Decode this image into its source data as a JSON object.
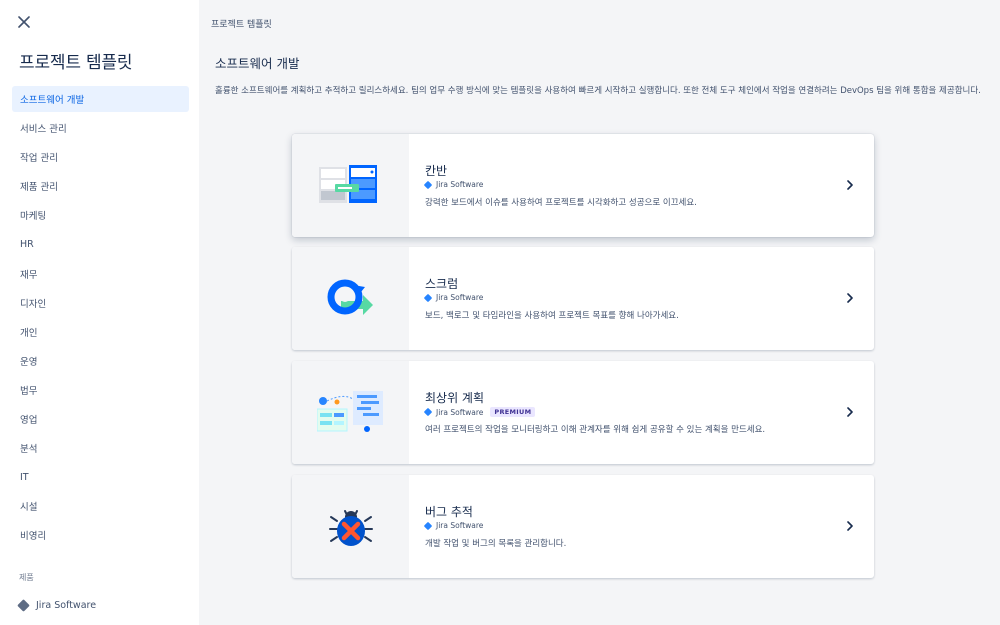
{
  "sidebar": {
    "title": "프로젝트 템플릿",
    "items": [
      {
        "label": "소프트웨어 개발"
      },
      {
        "label": "서비스 관리"
      },
      {
        "label": "작업 관리"
      },
      {
        "label": "제품 관리"
      },
      {
        "label": "마케팅"
      },
      {
        "label": "HR"
      },
      {
        "label": "재무"
      },
      {
        "label": "디자인"
      },
      {
        "label": "개인"
      },
      {
        "label": "운영"
      },
      {
        "label": "법무"
      },
      {
        "label": "영업"
      },
      {
        "label": "분석"
      },
      {
        "label": "IT"
      },
      {
        "label": "시설"
      },
      {
        "label": "비영리"
      }
    ],
    "active_index": 0,
    "products_heading": "제품",
    "product_label": "Jira Software"
  },
  "breadcrumb": "프로젝트 템플릿",
  "main": {
    "title": "소프트웨어 개발",
    "description": "훌륭한 소프트웨어를 계획하고 추적하고 릴리스하세요. 팀의 업무 수행 방식에 맞는 템플릿을 사용하여 빠르게 시작하고 실행합니다. 또한 전체 도구 체인에서 작업을 연결하려는 DevOps 팀을 위해 통합을 제공합니다.",
    "cards": [
      {
        "title": "칸반",
        "product": "Jira Software",
        "badge": "",
        "description": "강력한 보드에서 이슈를 사용하여 프로젝트를 시각화하고 성공으로 이끄세요.",
        "icon": "kanban-board-icon"
      },
      {
        "title": "스크럼",
        "product": "Jira Software",
        "badge": "",
        "description": "보드, 백로그 및 타임라인을 사용하여 프로젝트 목표를 향해 나아가세요.",
        "icon": "scrum-cycle-icon"
      },
      {
        "title": "최상위 계획",
        "product": "Jira Software",
        "badge": "PREMIUM",
        "description": "여러 프로젝트의 작업을 모니터링하고 이해 관계자를 위해 쉽게 공유할 수 있는 계획을 만드세요.",
        "icon": "top-level-plan-icon"
      },
      {
        "title": "버그 추적",
        "product": "Jira Software",
        "badge": "",
        "description": "개발 작업 및 버그의 목록을 관리합니다.",
        "icon": "bug-tracking-icon"
      }
    ]
  },
  "colors": {
    "accent": "#0c66e4",
    "active_bg": "#e9f2ff",
    "premium_bg": "#eae6ff",
    "premium_text": "#403294",
    "jira_blue": "#2684ff"
  }
}
